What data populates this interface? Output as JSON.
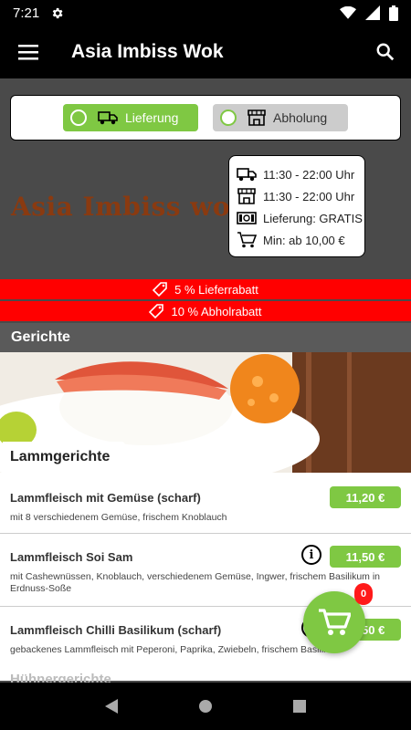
{
  "status_bar": {
    "time": "7:21",
    "icons": [
      "settings-icon",
      "wifi-icon",
      "signal-icon",
      "battery-icon"
    ]
  },
  "app_bar": {
    "title": "Asia Imbiss Wok",
    "menu_icon": "hamburger-menu-icon",
    "search_icon": "search-icon"
  },
  "order_mode": {
    "options": [
      {
        "label": "Lieferung",
        "icon": "delivery-truck-icon",
        "selected": true
      },
      {
        "label": "Abholung",
        "icon": "store-icon",
        "selected": false
      }
    ]
  },
  "restaurant": {
    "brand_name": "Asia Imbiss wok"
  },
  "info": {
    "delivery_hours": "11:30 - 22:00 Uhr",
    "pickup_hours": "11:30 - 22:00 Uhr",
    "delivery_fee": "Lieferung: GRATIS",
    "min_order": "Min: ab 10,00 €"
  },
  "promos": [
    {
      "text": "5 % Lieferrabatt",
      "icon": "tag-icon"
    },
    {
      "text": "10 % Abholrabatt",
      "icon": "tag-icon"
    }
  ],
  "section": {
    "title": "Gerichte"
  },
  "category": {
    "title": "Lammgerichte",
    "next_title": "Hühnergerichte"
  },
  "items": [
    {
      "name": "Lammfleisch mit Gemüse (scharf)",
      "desc": "mit 8 verschiedenem Gemüse, frischem Knoblauch",
      "price": "11,20 €"
    },
    {
      "name": "Lammfleisch Soi Sam",
      "desc": "mit Cashewnüssen, Knoblauch, verschiedenem Gemüse, Ingwer, frischem Basilikum in Erdnuss-Soße",
      "price": "11,50 €"
    },
    {
      "name": "Lammfleisch Chilli Basilikum (scharf)",
      "desc": "gebackenes Lammfleisch mit Peperoni, Paprika, Zwiebeln, frischem Basilikum",
      "price": "11,50 €"
    }
  ],
  "cart": {
    "count": "0"
  },
  "colors": {
    "accent": "#7fc843",
    "promo": "#ff0000",
    "brand_text": "#8a3a10"
  }
}
